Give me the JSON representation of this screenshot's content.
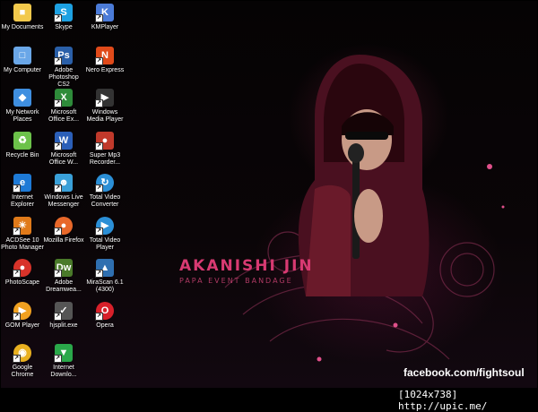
{
  "desktop": {
    "icons": [
      {
        "label": "My Documents",
        "icon": "folder-icon",
        "color": "#f2c94c"
      },
      {
        "label": "Skype",
        "icon": "skype-icon",
        "color": "#1da1e2"
      },
      {
        "label": "KMPlayer",
        "icon": "kmplayer-icon",
        "color": "#4b7bd8"
      },
      {
        "label": "My Computer",
        "icon": "computer-icon",
        "color": "#6aa7e8"
      },
      {
        "label": "Adobe Photoshop CS2",
        "icon": "photoshop-icon",
        "color": "#2a5fa8"
      },
      {
        "label": "Nero Express",
        "icon": "nero-icon",
        "color": "#e04a1a"
      },
      {
        "label": "My Network Places",
        "icon": "network-icon",
        "color": "#3f8fe0"
      },
      {
        "label": "Microsoft Office Ex...",
        "icon": "excel-icon",
        "color": "#2e8b3a"
      },
      {
        "label": "Windows Media Player",
        "icon": "media-player-icon",
        "color": "#333333"
      },
      {
        "label": "Recycle Bin",
        "icon": "recycle-bin-icon",
        "color": "#6cc24a"
      },
      {
        "label": "Microsoft Office W...",
        "icon": "word-icon",
        "color": "#2b5fb8"
      },
      {
        "label": "Super Mp3 Recorder...",
        "icon": "mp3-recorder-icon",
        "color": "#c0392b"
      },
      {
        "label": "Internet Explorer",
        "icon": "internet-explorer-icon",
        "color": "#1e7ad6"
      },
      {
        "label": "Windows Live Messenger",
        "icon": "messenger-icon",
        "color": "#3aa0d8"
      },
      {
        "label": "Total Video Converter",
        "icon": "video-converter-icon",
        "color": "#2b8fd6"
      },
      {
        "label": "ACDSee 10 Photo Manager",
        "icon": "acdsee-icon",
        "color": "#e07a1a"
      },
      {
        "label": "Mozilla Firefox",
        "icon": "firefox-icon",
        "color": "#e8682a"
      },
      {
        "label": "Total Video Player",
        "icon": "video-player-icon",
        "color": "#2b8fd6"
      },
      {
        "label": "PhotoScape",
        "icon": "photoscape-icon",
        "color": "#d8332a"
      },
      {
        "label": "Adobe Dreamwea...",
        "icon": "dreamweaver-icon",
        "color": "#4a7a2a"
      },
      {
        "label": "MiraScan 6.1 (4300)",
        "icon": "mirascan-icon",
        "color": "#2f6fb0"
      },
      {
        "label": "GOM Player",
        "icon": "gom-player-icon",
        "color": "#f0a020"
      },
      {
        "label": "hjsplit.exe",
        "icon": "hjsplit-icon",
        "color": "#555555"
      },
      {
        "label": "Opera",
        "icon": "opera-icon",
        "color": "#d8202a"
      },
      {
        "label": "Google Chrome",
        "icon": "chrome-icon",
        "color": "#e8b020"
      },
      {
        "label": "Internet Downlo...",
        "icon": "idm-icon",
        "color": "#2aa84a"
      }
    ]
  },
  "wallpaper": {
    "title": "AKANISHI JIN",
    "subtitle": "PAPA EVENT BANDAGE",
    "caption": "facebook.com/fightsoul",
    "accent_color": "#d83a72"
  },
  "watermark": "[1024x738] http://upic.me/"
}
